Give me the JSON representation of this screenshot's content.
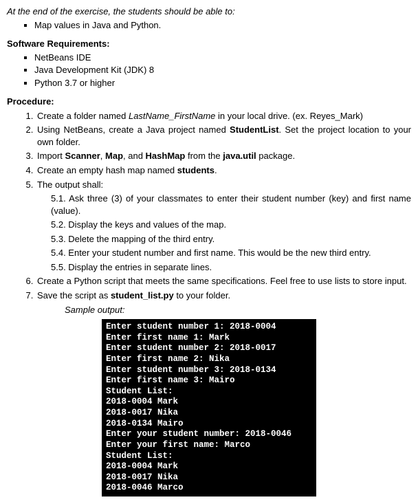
{
  "intro": "At the end of the exercise, the students should be able to:",
  "objectives": [
    "Map values in Java and Python."
  ],
  "sw_head": "Software Requirements:",
  "software": [
    "NetBeans IDE",
    "Java Development Kit (JDK) 8",
    "Python 3.7 or higher"
  ],
  "proc_head": "Procedure:",
  "p1_a": "Create a folder named ",
  "p1_b": "LastName_FirstName",
  "p1_c": " in your local drive. (ex. Reyes_Mark)",
  "p2_a": "Using NetBeans, create a Java project named ",
  "p2_b": "StudentList",
  "p2_c": ". Set the project location to your own folder.",
  "p3_a": "Import ",
  "p3_b": "Scanner",
  "p3_c": ", ",
  "p3_d": "Map",
  "p3_e": ", and ",
  "p3_f": "HashMap",
  "p3_g": " from the ",
  "p3_h": "java.util",
  "p3_i": " package.",
  "p4_a": "Create an empty hash map named ",
  "p4_b": "students",
  "p4_c": ".",
  "p5": "The output shall:",
  "p5_1": "5.1.  Ask three (3) of your classmates to enter their student number (key) and first name (value).",
  "p5_2": "5.2.  Display the keys and values of the map.",
  "p5_3": "5.3.  Delete the mapping of the third entry.",
  "p5_4": "5.4.  Enter your student number and first name. This would be the new third entry.",
  "p5_5": "5.5.  Display the entries in separate lines.",
  "p6": "Create a Python script that meets the same specifications. Feel free to use lists to store input.",
  "p7_a": "Save the script as ",
  "p7_b": "student_list.py",
  "p7_c": " to your folder.",
  "sample_label": "Sample output:",
  "terminal": "Enter student number 1: 2018-0004\nEnter first name 1: Mark\nEnter student number 2: 2018-0017\nEnter first name 2: Nika\nEnter student number 3: 2018-0134\nEnter first name 3: Mairo\nStudent List:\n2018-0004 Mark\n2018-0017 Nika\n2018-0134 Mairo\nEnter your student number: 2018-0046\nEnter your first name: Marco\nStudent List:\n2018-0004 Mark\n2018-0017 Nika\n2018-0046 Marco"
}
